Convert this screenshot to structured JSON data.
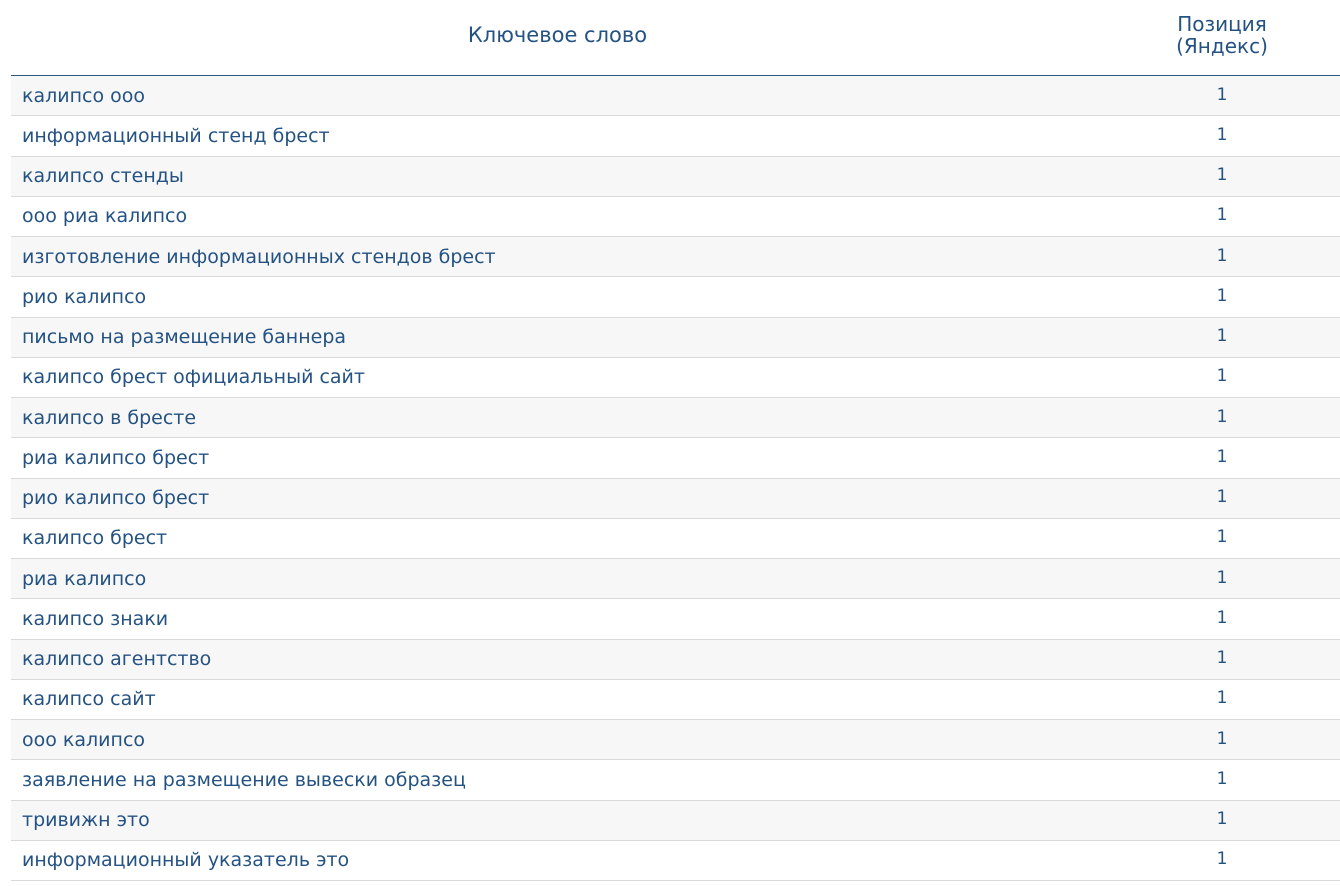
{
  "table": {
    "headers": {
      "keyword": "Ключевое слово",
      "position_line1": "Позиция",
      "position_line2": "(Яндекс)"
    },
    "rows": [
      {
        "keyword": "калипсо ооо",
        "position": "1"
      },
      {
        "keyword": "информационный стенд брест",
        "position": "1"
      },
      {
        "keyword": "калипсо стенды",
        "position": "1"
      },
      {
        "keyword": "ооо риа калипсо",
        "position": "1"
      },
      {
        "keyword": "изготовление информационных стендов брест",
        "position": "1"
      },
      {
        "keyword": "рио калипсо",
        "position": "1"
      },
      {
        "keyword": "письмо на размещение баннера",
        "position": "1"
      },
      {
        "keyword": "калипсо брест официальный сайт",
        "position": "1"
      },
      {
        "keyword": "калипсо в бресте",
        "position": "1"
      },
      {
        "keyword": "риа калипсо брест",
        "position": "1"
      },
      {
        "keyword": "рио калипсо брест",
        "position": "1"
      },
      {
        "keyword": "калипсо брест",
        "position": "1"
      },
      {
        "keyword": "риа калипсо",
        "position": "1"
      },
      {
        "keyword": "калипсо знаки",
        "position": "1"
      },
      {
        "keyword": "калипсо агентство",
        "position": "1"
      },
      {
        "keyword": "калипсо сайт",
        "position": "1"
      },
      {
        "keyword": "ооо калипсо",
        "position": "1"
      },
      {
        "keyword": "заявление на размещение вывески образец",
        "position": "1"
      },
      {
        "keyword": "тривижн это",
        "position": "1"
      },
      {
        "keyword": "информационный указатель это",
        "position": "1"
      }
    ]
  },
  "colors": {
    "text": "#245283",
    "header_rule": "#2d5a80",
    "row_alt": "#f7f7f7",
    "row_divider": "#d9d9d9"
  }
}
